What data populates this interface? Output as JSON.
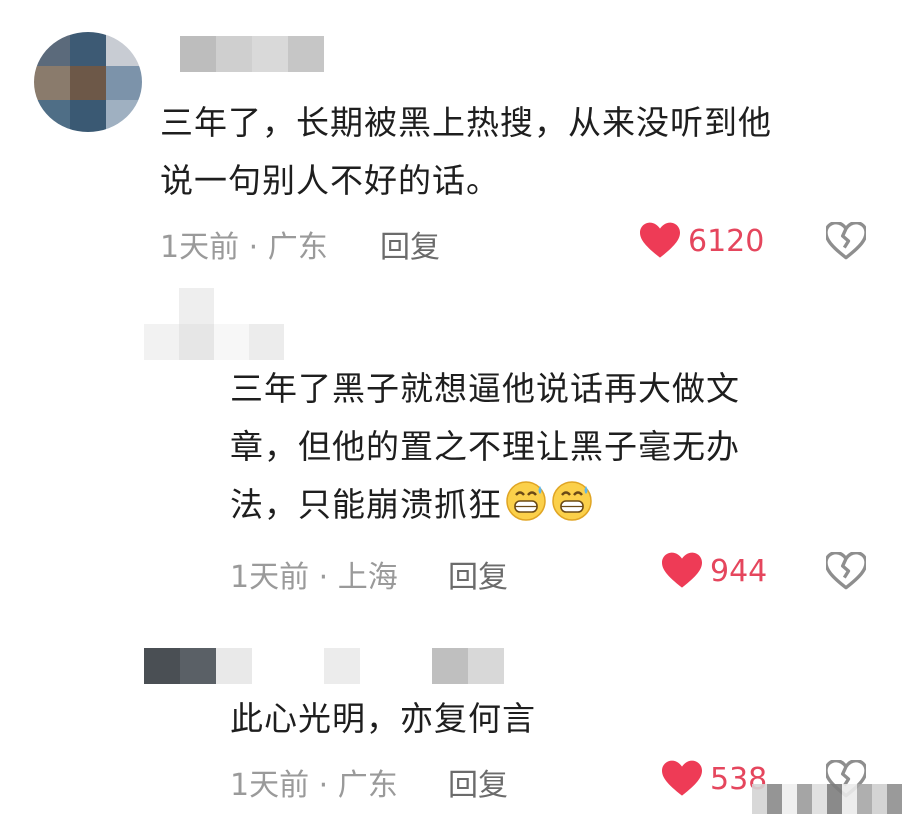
{
  "comments": [
    {
      "text_line1": "三年了，长期被黑上热搜，从来没听到他",
      "text_line2": "说一句别人不好的话。",
      "time": "1天前",
      "sep": "·",
      "location": "广东",
      "reply_label": "回复",
      "likes": "6120"
    },
    {
      "text_line1": "三年了黑子就想逼他说话再大做文",
      "text_line2": "章，但他的置之不理让黑子毫无办",
      "text_line3": "法，只能崩溃抓狂",
      "time": "1天前",
      "sep": "·",
      "location": "上海",
      "reply_label": "回复",
      "likes": "944"
    },
    {
      "text_line1": "此心光明，亦复何言",
      "time": "1天前",
      "sep": "·",
      "location": "广东",
      "reply_label": "回复",
      "likes": "538"
    }
  ],
  "icons": {
    "like": "heart-icon",
    "dislike": "broken-heart-icon",
    "emoji": "sweat-grin-emoji"
  },
  "colors": {
    "like_red": "#e5465d",
    "meta_gray": "#9a9a9a"
  }
}
